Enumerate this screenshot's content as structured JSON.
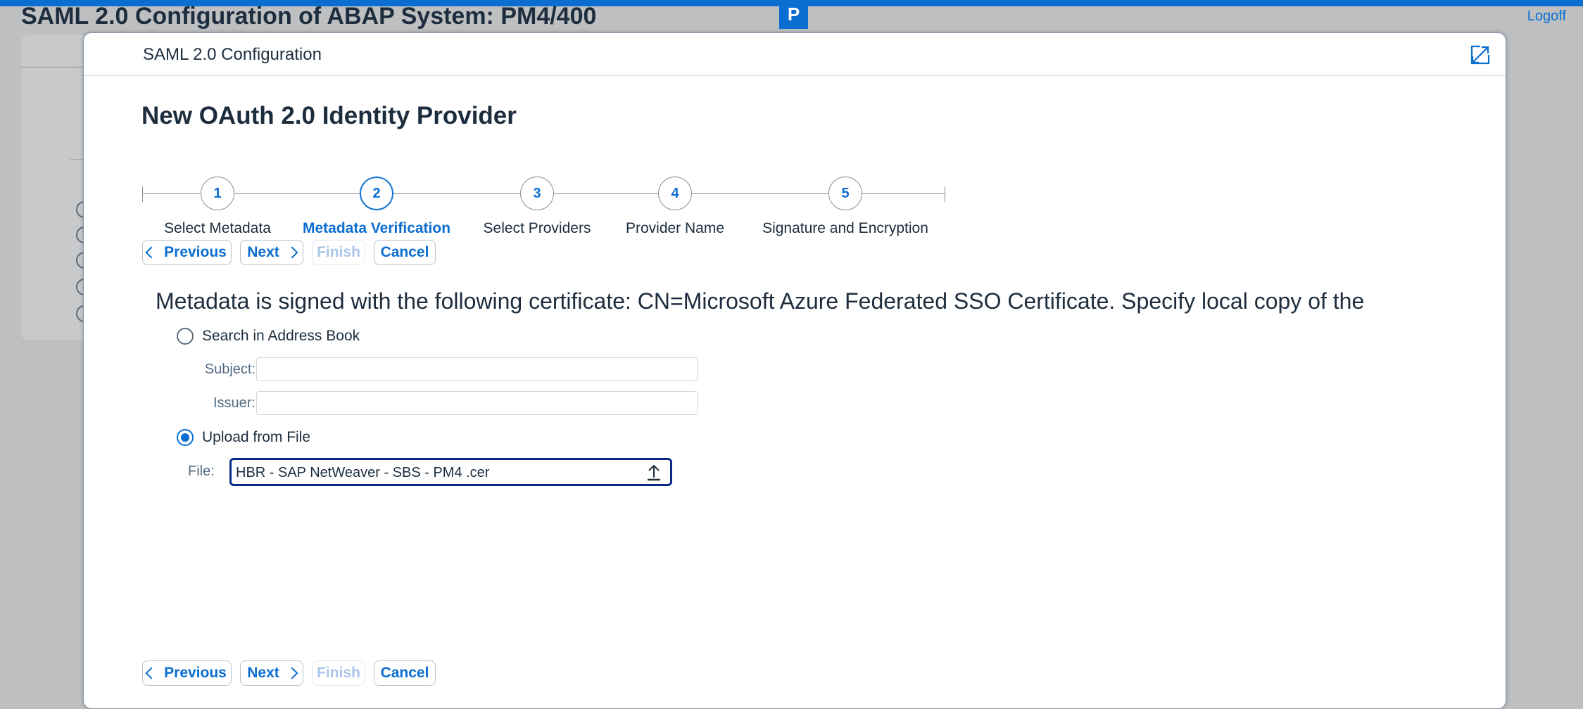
{
  "background": {
    "page_title": "SAML 2.0 Configuration of ABAP System: PM4/400",
    "logoff_label": "Logoff"
  },
  "dialog": {
    "title": "SAML 2.0 Configuration",
    "heading": "New OAuth 2.0 Identity Provider",
    "steps": [
      {
        "number": "1",
        "label": "Select Metadata",
        "active": false
      },
      {
        "number": "2",
        "label": "Metadata Verification",
        "active": true
      },
      {
        "number": "3",
        "label": "Select Providers",
        "active": false
      },
      {
        "number": "4",
        "label": "Provider Name",
        "active": false
      },
      {
        "number": "5",
        "label": "Signature and Encryption",
        "active": false
      }
    ],
    "buttons": {
      "previous": "Previous",
      "next": "Next",
      "finish": "Finish",
      "cancel": "Cancel"
    },
    "info_text": "Metadata is signed with the following certificate: CN=Microsoft Azure Federated SSO Certificate. Specify local copy of the",
    "options": {
      "search_address_book": "Search in Address Book",
      "upload_from_file": "Upload from File",
      "selected": "upload_from_file"
    },
    "fields": {
      "subject_label": "Subject:",
      "subject_value": "",
      "issuer_label": "Issuer:",
      "issuer_value": "",
      "file_label": "File:",
      "file_value": "HBR - SAP NetWeaver - SBS - PM4 .cer"
    }
  },
  "colors": {
    "accent": "#0a6ed1",
    "text": "#1d2d3e",
    "disabled": "#a9c6e8"
  }
}
